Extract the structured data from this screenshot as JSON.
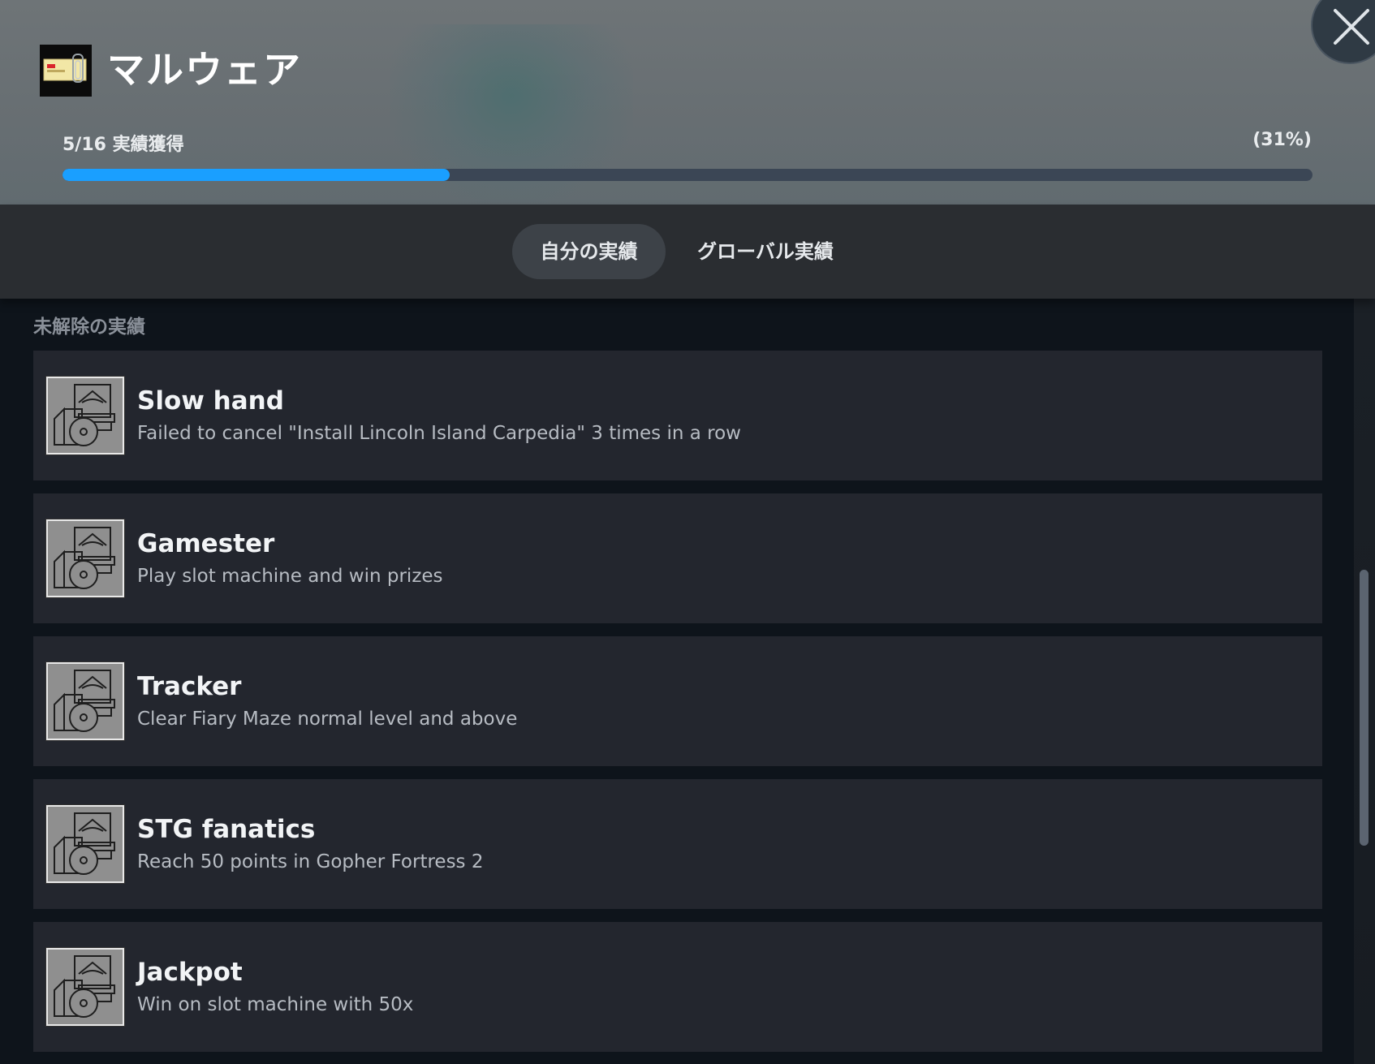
{
  "header": {
    "game_title": "マルウェア",
    "progress_label": "5/16 実績獲得",
    "progress_percent_label": "(31%)",
    "progress_fraction": 0.31,
    "accent_color": "#1a9fff",
    "game_icon": "malware-game-icon",
    "close_icon": "close-icon"
  },
  "tabs": [
    {
      "label": "自分の実績",
      "active": true
    },
    {
      "label": "グローバル実績",
      "active": false
    }
  ],
  "section": {
    "title": "未解除の実績"
  },
  "achievements": [
    {
      "name": "Slow hand",
      "description": "Failed to cancel \"Install Lincoln Island Carpedia\" 3 times in a row",
      "icon": "locked-achievement-icon"
    },
    {
      "name": "Gamester",
      "description": "Play slot machine and win prizes",
      "icon": "locked-achievement-icon"
    },
    {
      "name": "Tracker",
      "description": "Clear Fiary Maze normal level and above",
      "icon": "locked-achievement-icon"
    },
    {
      "name": "STG fanatics",
      "description": "Reach 50 points in Gopher Fortress 2",
      "icon": "locked-achievement-icon"
    },
    {
      "name": "Jackpot",
      "description": "Win on slot machine with 50x",
      "icon": "locked-achievement-icon"
    }
  ]
}
